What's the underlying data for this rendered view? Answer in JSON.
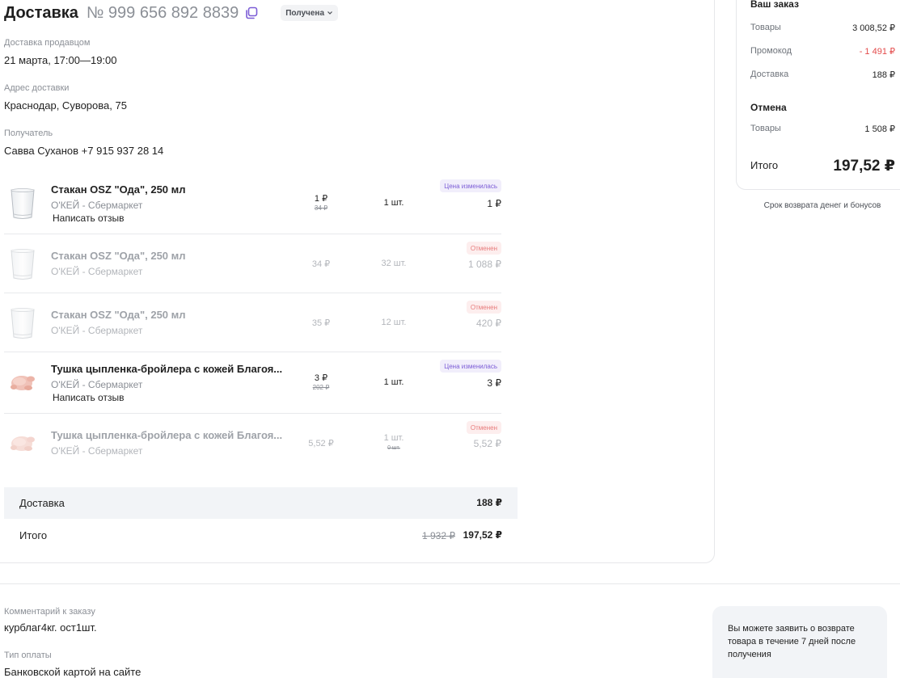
{
  "header": {
    "title": "Доставка",
    "order_number": "№ 999 656 892 8839",
    "status": "Получена"
  },
  "info": {
    "seller_delivery_label": "Доставка продавцом",
    "seller_delivery_value": "21 марта, 17:00—19:00",
    "address_label": "Адрес доставки",
    "address_value": "Краснодар, Суворова, 75",
    "recipient_label": "Получатель",
    "recipient_value": "Савва Суханов +7 915 937 28 14"
  },
  "items": [
    {
      "name": "Стакан OSZ \"Ода\", 250 мл",
      "seller": "О'КЕЙ - Сбермаркет",
      "review": "Написать отзыв",
      "price": "1 ₽",
      "old_price": "34 ₽",
      "qty": "1 шт.",
      "total": "1 ₽",
      "badge": "Цена изменилась"
    },
    {
      "name": "Стакан OSZ \"Ода\", 250 мл",
      "seller": "О'КЕЙ - Сбермаркет",
      "price": "34 ₽",
      "qty": "32 шт.",
      "total": "1 088 ₽",
      "badge": "Отменен"
    },
    {
      "name": "Стакан OSZ \"Ода\", 250 мл",
      "seller": "О'КЕЙ - Сбермаркет",
      "price": "35 ₽",
      "qty": "12 шт.",
      "total": "420 ₽",
      "badge": "Отменен"
    },
    {
      "name": "Тушка цыпленка-бройлера с кожей Благоя...",
      "seller": "О'КЕЙ - Сбермаркет",
      "review": "Написать отзыв",
      "price": "3 ₽",
      "old_price": "202 ₽",
      "qty": "1 шт.",
      "total": "3 ₽",
      "badge": "Цена изменилась"
    },
    {
      "name": "Тушка цыпленка-бройлера с кожей Благоя...",
      "seller": "О'КЕЙ - Сбермаркет",
      "price": "5,52 ₽",
      "qty": "1 шт.",
      "old_qty": "0 шт.",
      "total": "5,52 ₽",
      "badge": "Отменен"
    }
  ],
  "summary": {
    "delivery_label": "Доставка",
    "delivery_value": "188 ₽",
    "total_label": "Итого",
    "total_old": "1 932 ₽",
    "total_value": "197,52 ₽"
  },
  "order_card": {
    "title": "Ваш заказ",
    "goods_label": "Товары",
    "goods_value": "3 008,52 ₽",
    "promo_label": "Промокод",
    "promo_value": "- 1 491 ₽",
    "delivery_label": "Доставка",
    "delivery_value": "188 ₽",
    "cancel_title": "Отмена",
    "cancel_goods_label": "Товары",
    "cancel_goods_value": "1 508 ₽",
    "total_label": "Итого",
    "total_value": "197,52 ₽"
  },
  "refund_link": "Срок возврата денег и бонусов",
  "bottom": {
    "comment_label": "Комментарий к заказу",
    "comment_value": "курблаг4кг. ост1шт.",
    "payment_label": "Тип оплаты",
    "payment_value": "Банковской картой на сайте"
  },
  "notice": "Вы можете заявить о возврате товара в течение 7 дней после получения",
  "colors": {
    "accent": "#7b5cd6",
    "promo_red": "#e34b4b",
    "cancel_badge": "#e77b7b"
  }
}
